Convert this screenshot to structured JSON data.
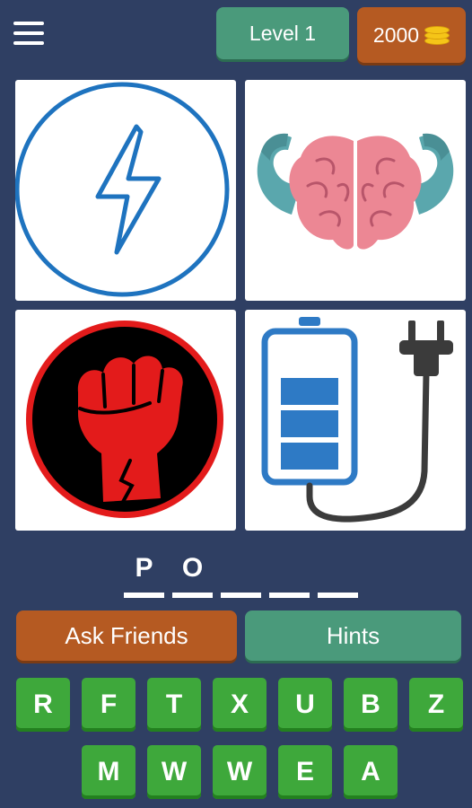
{
  "header": {
    "level_label": "Level 1",
    "coins": "2000"
  },
  "tiles": [
    {
      "icon": "lightning-bolt-circle-icon"
    },
    {
      "icon": "muscular-brain-icon"
    },
    {
      "icon": "raised-fist-icon"
    },
    {
      "icon": "battery-plug-icon"
    }
  ],
  "answer": {
    "letters": [
      "P",
      "O",
      "",
      "",
      ""
    ]
  },
  "actions": {
    "ask_friends_label": "Ask Friends",
    "hints_label": "Hints"
  },
  "keyboard": {
    "row1": [
      "R",
      "F",
      "T",
      "X",
      "U",
      "B",
      "Z"
    ],
    "row2": [
      "M",
      "W",
      "W",
      "E",
      "A"
    ]
  },
  "colors": {
    "background": "#2f3f63",
    "green_accent": "#4a9a7b",
    "orange_accent": "#b55a22",
    "key_green": "#3ea83b"
  }
}
